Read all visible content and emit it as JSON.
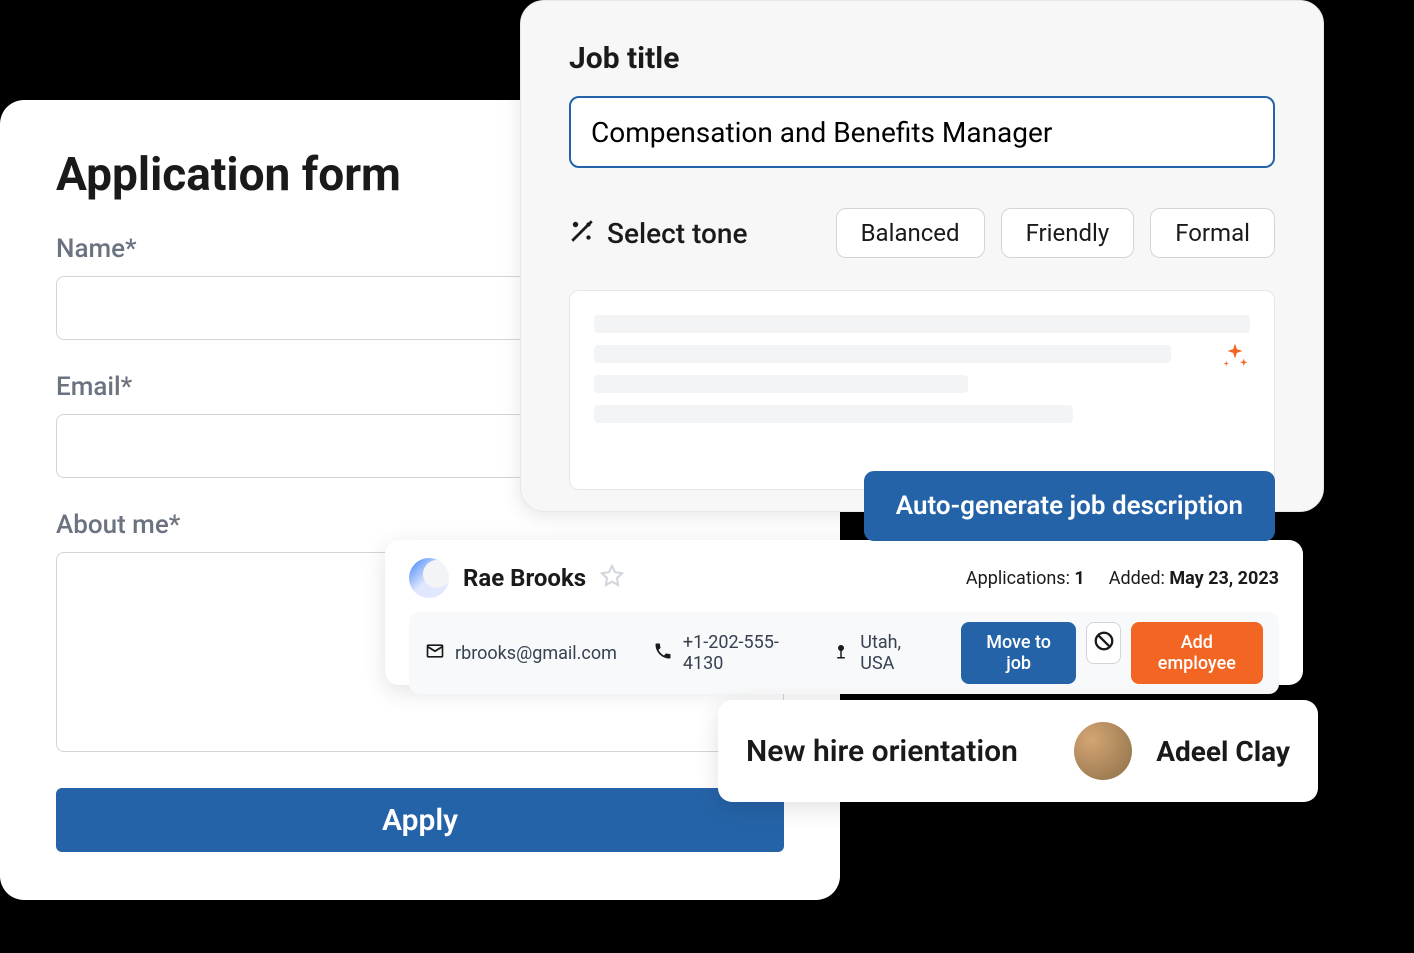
{
  "applicationForm": {
    "title": "Application form",
    "nameLabel": "Name*",
    "emailLabel": "Email*",
    "aboutLabel": "About me*",
    "applyButton": "Apply"
  },
  "jobCard": {
    "titleLabel": "Job title",
    "titleValue": "Compensation and Benefits Manager",
    "selectToneLabel": "Select tone",
    "tones": {
      "balanced": "Balanced",
      "friendly": "Friendly",
      "formal": "Formal"
    },
    "autoGenButton": "Auto-generate job description"
  },
  "candidate": {
    "name": "Rae Brooks",
    "applicationsLabel": "Applications:",
    "applicationsValue": "1",
    "addedLabel": "Added:",
    "addedValue": "May 23, 2023",
    "email": "rbrooks@gmail.com",
    "phone": "+1-202-555-4130",
    "location": "Utah, USA",
    "moveButton": "Move to job",
    "addEmployeeButton": "Add employee"
  },
  "orientation": {
    "title": "New hire orientation",
    "personName": "Adeel Clay"
  }
}
